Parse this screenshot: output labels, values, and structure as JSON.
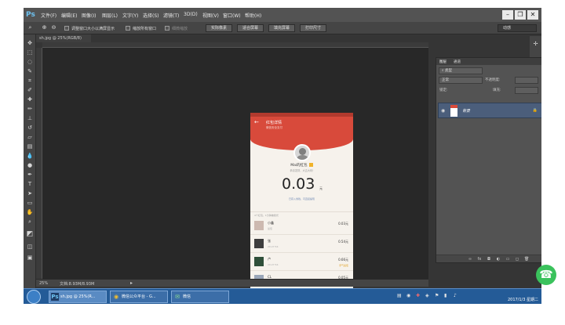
{
  "app": {
    "logo": "Ps",
    "menu": [
      "文件(F)",
      "编辑(E)",
      "图像(I)",
      "图层(L)",
      "文字(Y)",
      "选择(S)",
      "滤镜(T)",
      "3D(D)",
      "视图(V)",
      "窗口(W)",
      "帮助(H)"
    ],
    "window_buttons": [
      "–",
      "❐",
      "✕"
    ]
  },
  "options_bar": {
    "resize_windows_label": "调整窗口大小以满屏显示",
    "zoom_all_label": "缩放所有窗口",
    "scrubby_label": "细微缩放",
    "buttons": [
      "实际像素",
      "适合屏幕",
      "填充屏幕",
      "打印尺寸"
    ],
    "workspace": "动感"
  },
  "document": {
    "tab_title": "sh.jpg @ 25%(RGB/8)",
    "zoom": "25%",
    "doc_info": "文档:8.93M/8.93M"
  },
  "phone": {
    "title": "红包详情",
    "subtitle": "微信安全支付",
    "sender": "Mai的红包",
    "blessing": "恭喜发财，大吉大利!",
    "amount": "0.03",
    "amount_unit": "元",
    "amount_note": "已存入零钱，可直接提现",
    "list_header": "4个红包，1分钟被抢光",
    "records": [
      {
        "name": "小鑫",
        "time": "最佳",
        "amount": "0.03元",
        "tag": ""
      },
      {
        "name": "张",
        "time": "20:27:54",
        "amount": "0.54元",
        "tag": ""
      },
      {
        "name": "卢",
        "time": "20:27:54",
        "amount": "0.66元",
        "tag": "手气最佳"
      },
      {
        "name": "CL",
        "time": "20:27:46",
        "amount": "0.05元",
        "tag": ""
      }
    ]
  },
  "layers_panel": {
    "tabs": [
      "图层",
      "通道"
    ],
    "kind": "类型",
    "blend_mode": "正常",
    "opacity_label": "不透明度:",
    "lock_label": "锁定:",
    "fill_label": "填充:",
    "layer_name": "背景"
  },
  "taskbar": {
    "tasks": [
      {
        "label": "sh.jpg @ 25%(R...",
        "icon": "Ps"
      },
      {
        "label": "微信公众平台 - G...",
        "icon": "◉"
      },
      {
        "label": "微信",
        "icon": "✉"
      }
    ],
    "clock": "2017/1/3 星期二"
  },
  "icons": {
    "zoom": "zoom-icon",
    "eye": "eye-icon",
    "lock": "lock-icon"
  },
  "colors": {
    "accent_red": "#d84a3b",
    "ps_blue": "#6ec3f2",
    "layer_select": "#4b5e7b",
    "taskbar": "#245b97"
  }
}
